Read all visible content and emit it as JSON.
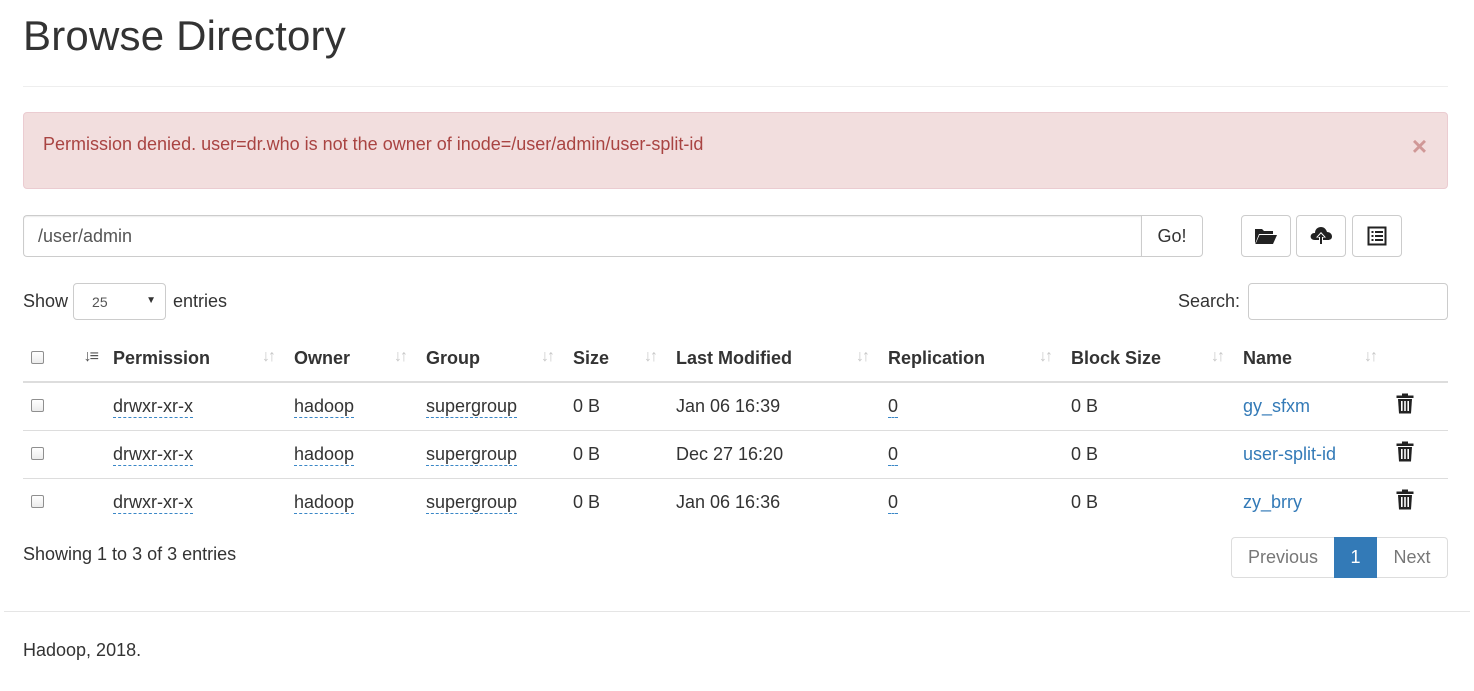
{
  "page": {
    "title": "Browse Directory"
  },
  "alert": {
    "message": "Permission denied. user=dr.who is not the owner of inode=/user/admin/user-split-id",
    "close_label": "×"
  },
  "path_bar": {
    "value": "/user/admin",
    "go_label": "Go!"
  },
  "toolbar": {
    "icons": [
      "folder-open-icon",
      "cloud-upload-icon",
      "list-alt-icon"
    ]
  },
  "length": {
    "show_label": "Show",
    "selected": "25",
    "entries_label": "entries"
  },
  "search": {
    "label": "Search:",
    "value": ""
  },
  "table": {
    "columns": [
      "Permission",
      "Owner",
      "Group",
      "Size",
      "Last Modified",
      "Replication",
      "Block Size",
      "Name"
    ],
    "rows": [
      {
        "permission": "drwxr-xr-x",
        "owner": "hadoop",
        "group": "supergroup",
        "size": "0 B",
        "modified": "Jan 06 16:39",
        "replication": "0",
        "block_size": "0 B",
        "name": "gy_sfxm"
      },
      {
        "permission": "drwxr-xr-x",
        "owner": "hadoop",
        "group": "supergroup",
        "size": "0 B",
        "modified": "Dec 27 16:20",
        "replication": "0",
        "block_size": "0 B",
        "name": "user-split-id"
      },
      {
        "permission": "drwxr-xr-x",
        "owner": "hadoop",
        "group": "supergroup",
        "size": "0 B",
        "modified": "Jan 06 16:36",
        "replication": "0",
        "block_size": "0 B",
        "name": "zy_brry"
      }
    ]
  },
  "info": {
    "text": "Showing 1 to 3 of 3 entries"
  },
  "pagination": {
    "previous": "Previous",
    "current": "1",
    "next": "Next"
  },
  "footer": {
    "text": "Hadoop, 2018."
  },
  "colors": {
    "alert_bg": "#f2dede",
    "alert_text": "#a94442",
    "link": "#337ab7",
    "active_page": "#337ab7"
  }
}
